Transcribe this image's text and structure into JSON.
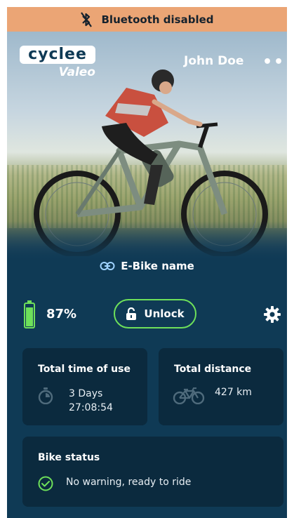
{
  "banner": {
    "text": "Bluetooth disabled",
    "icon": "bluetooth-disabled-icon",
    "color": "#eba575"
  },
  "header": {
    "logo_brand": "cyclee",
    "logo_sub": "Valeo",
    "user_name": "John Doe",
    "menu": "•••"
  },
  "bike": {
    "name": "E-Bike name",
    "link_icon": "link-icon"
  },
  "battery": {
    "percent": "87%",
    "level": 0.87,
    "color": "#6ee05a"
  },
  "actions": {
    "unlock_label": "Unlock",
    "lock_icon": "unlock-icon",
    "settings_icon": "gear-icon"
  },
  "stats": {
    "time_title": "Total time of use",
    "time_days": "3 Days",
    "time_clock": "27:08:54",
    "distance_title": "Total distance",
    "distance_value": "427 km"
  },
  "status": {
    "title": "Bike status",
    "message": "No warning, ready to ride",
    "icon": "check-circle-icon"
  },
  "colors": {
    "accent": "#6ee05a",
    "background": "#0f3a55",
    "card": "#0b2a3e"
  }
}
